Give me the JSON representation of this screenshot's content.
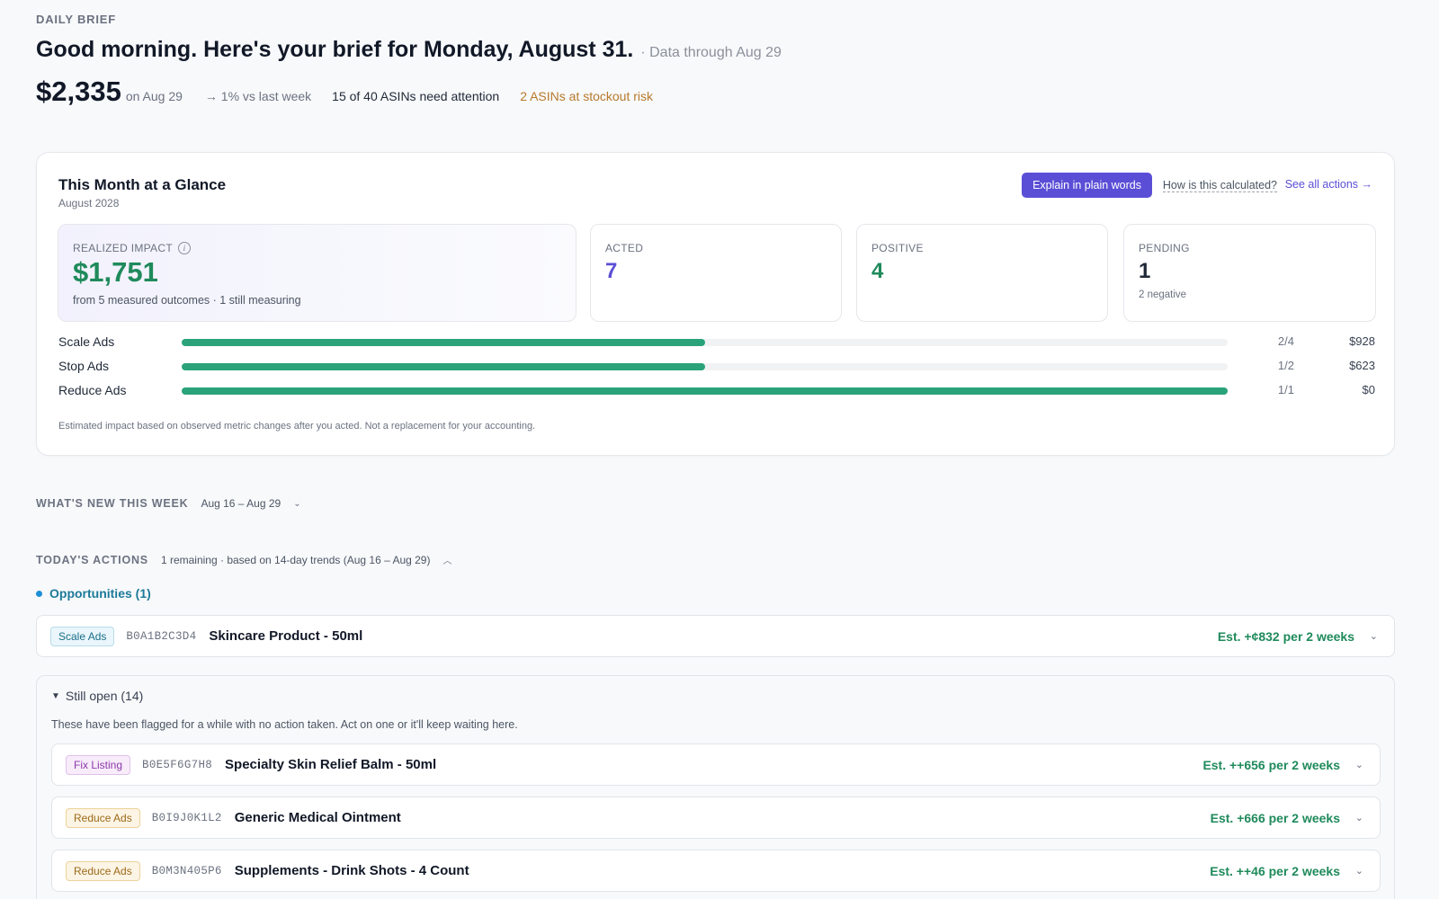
{
  "header": {
    "eyebrow": "DAILY BRIEF",
    "headline": "Good morning. Here's your brief for Monday, August 31.",
    "data_through": "· Data through Aug 29",
    "amount": "$2,335",
    "amount_date": "on Aug 29",
    "trend": "→ 1% vs last week",
    "asins_attention": "15 of 40 ASINs need attention",
    "stockout_risk": "2 ASINs at stockout risk"
  },
  "glance": {
    "title": "This Month at a Glance",
    "month": "August 2028",
    "explain_button": "Explain in plain words",
    "how_link": "How is this calculated?",
    "see_all": "See all actions →",
    "realized": {
      "label": "REALIZED IMPACT",
      "value": "$1,751",
      "note": "from 5 measured outcomes · 1 still measuring"
    },
    "acted": {
      "label": "ACTED",
      "value": "7"
    },
    "positive": {
      "label": "POSITIVE",
      "value": "4"
    },
    "pending": {
      "label": "PENDING",
      "value": "1",
      "note": "2 negative"
    },
    "bars": [
      {
        "name": "Scale Ads",
        "ratio": "2/4",
        "fraction": 0.5,
        "amount": "$928"
      },
      {
        "name": "Stop Ads",
        "ratio": "1/2",
        "fraction": 0.5,
        "amount": "$623"
      },
      {
        "name": "Reduce Ads",
        "ratio": "1/1",
        "fraction": 1.0,
        "amount": "$0"
      }
    ],
    "disclaimer": "Estimated impact based on observed metric changes after you acted. Not a replacement for your accounting."
  },
  "whats_new": {
    "heading": "WHAT'S NEW THIS WEEK",
    "range": "Aug 16 – Aug 29",
    "chevron": "⌄"
  },
  "todays_actions": {
    "heading": "TODAY'S ACTIONS",
    "meta": "1 remaining · based on 14-day trends (Aug 16 – Aug 29)",
    "chevron": "︿"
  },
  "opportunities": {
    "label": "Opportunities (1)",
    "items": [
      {
        "tag": "Scale Ads",
        "asin": "B0A1B2C3D4",
        "name": "Skincare Product - 50ml",
        "est": "Est. +¢832 per 2 weeks"
      }
    ]
  },
  "still_open": {
    "label": "Still open (14)",
    "message": "These have been flagged for a while with no action taken. Act on one or it'll keep waiting here.",
    "items": [
      {
        "tag": "Fix Listing",
        "asin": "B0E5F6G7H8",
        "name": "Specialty Skin Relief Balm - 50ml",
        "est": "Est. ++656 per 2 weeks"
      },
      {
        "tag": "Reduce Ads",
        "asin": "B0I9J0K1L2",
        "name": "Generic Medical Ointment",
        "est": "Est. +666 per 2 weeks"
      },
      {
        "tag": "Reduce Ads",
        "asin": "B0M3N405P6",
        "name": "Supplements - Drink Shots - 4 Count",
        "est": "Est. ++46 per 2 weeks"
      }
    ]
  },
  "colors": {
    "accent": "#5b4ed6",
    "positive": "#1f8a5b",
    "bar": "#2aa37a",
    "warning": "#b7792b"
  },
  "icons": {
    "info": "info-icon",
    "chevron": "chevron-down-icon",
    "triangle": "triangle-down-icon"
  }
}
